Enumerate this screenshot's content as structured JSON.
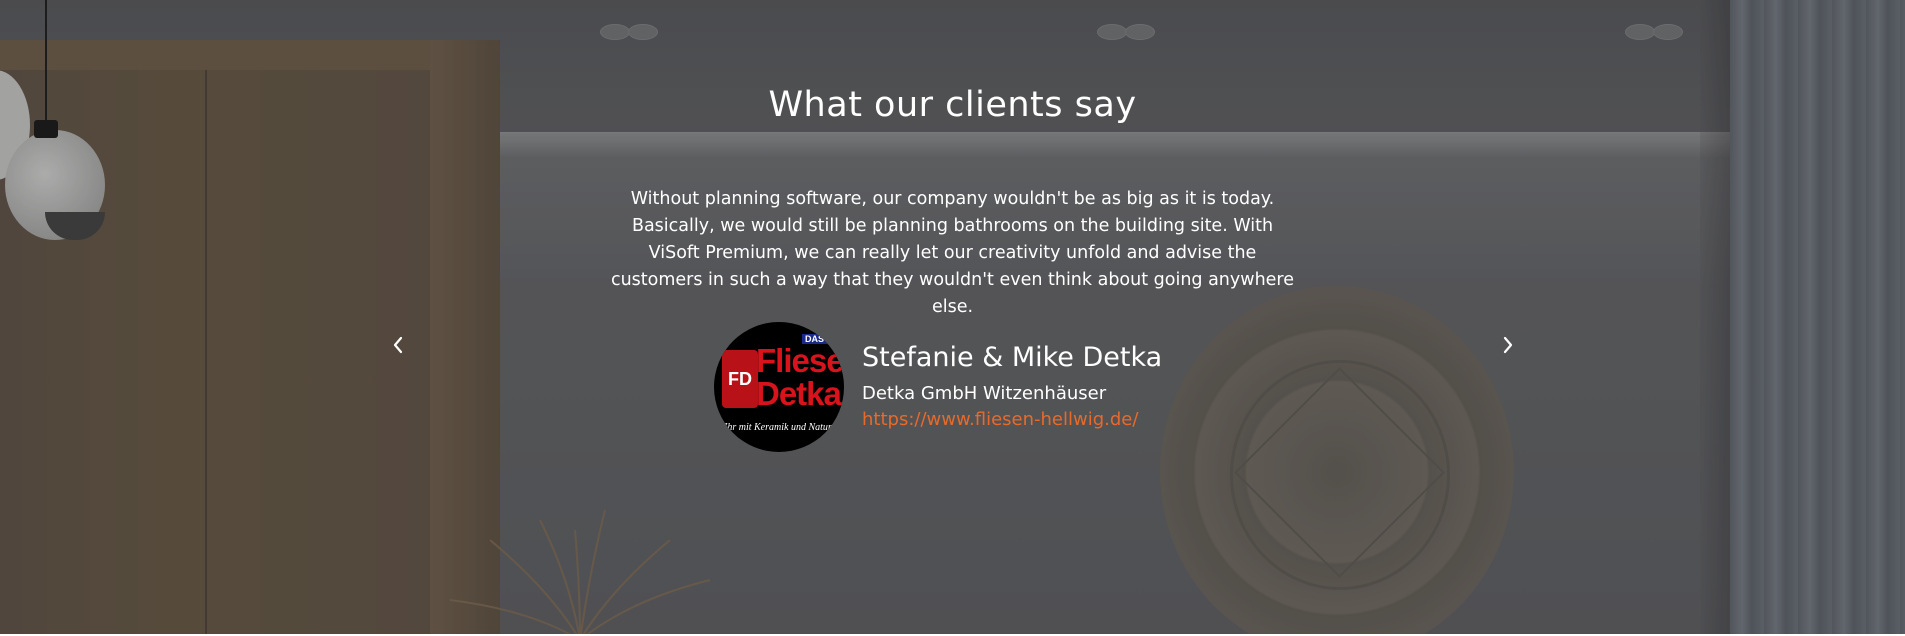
{
  "testimonials": {
    "title": "What our clients say",
    "quote": "Without planning software, our company wouldn't be as big as it is today. Basically, we would still be planning bathrooms on the building site. With ViSoft Premium, we can really let our creativity unfold and advise the customers in such a way that they wouldn't even think about going anywhere else.",
    "author": {
      "name": "Stefanie & Mike Detka",
      "company": "Detka GmbH Witzenhäuser",
      "url": "https://www.fliesen-hellwig.de/",
      "logo": {
        "name_line1": "Fliesen",
        "name_line2": "Detka",
        "mark": "FD",
        "badge": "DAS",
        "tagline": "Ihr mit Keramik und Naturstein"
      }
    },
    "prev_icon": "chevron-left-icon",
    "next_icon": "chevron-right-icon",
    "colors": {
      "link": "#e86a2a",
      "text": "#ffffff",
      "logo_red": "#d8131b"
    }
  }
}
